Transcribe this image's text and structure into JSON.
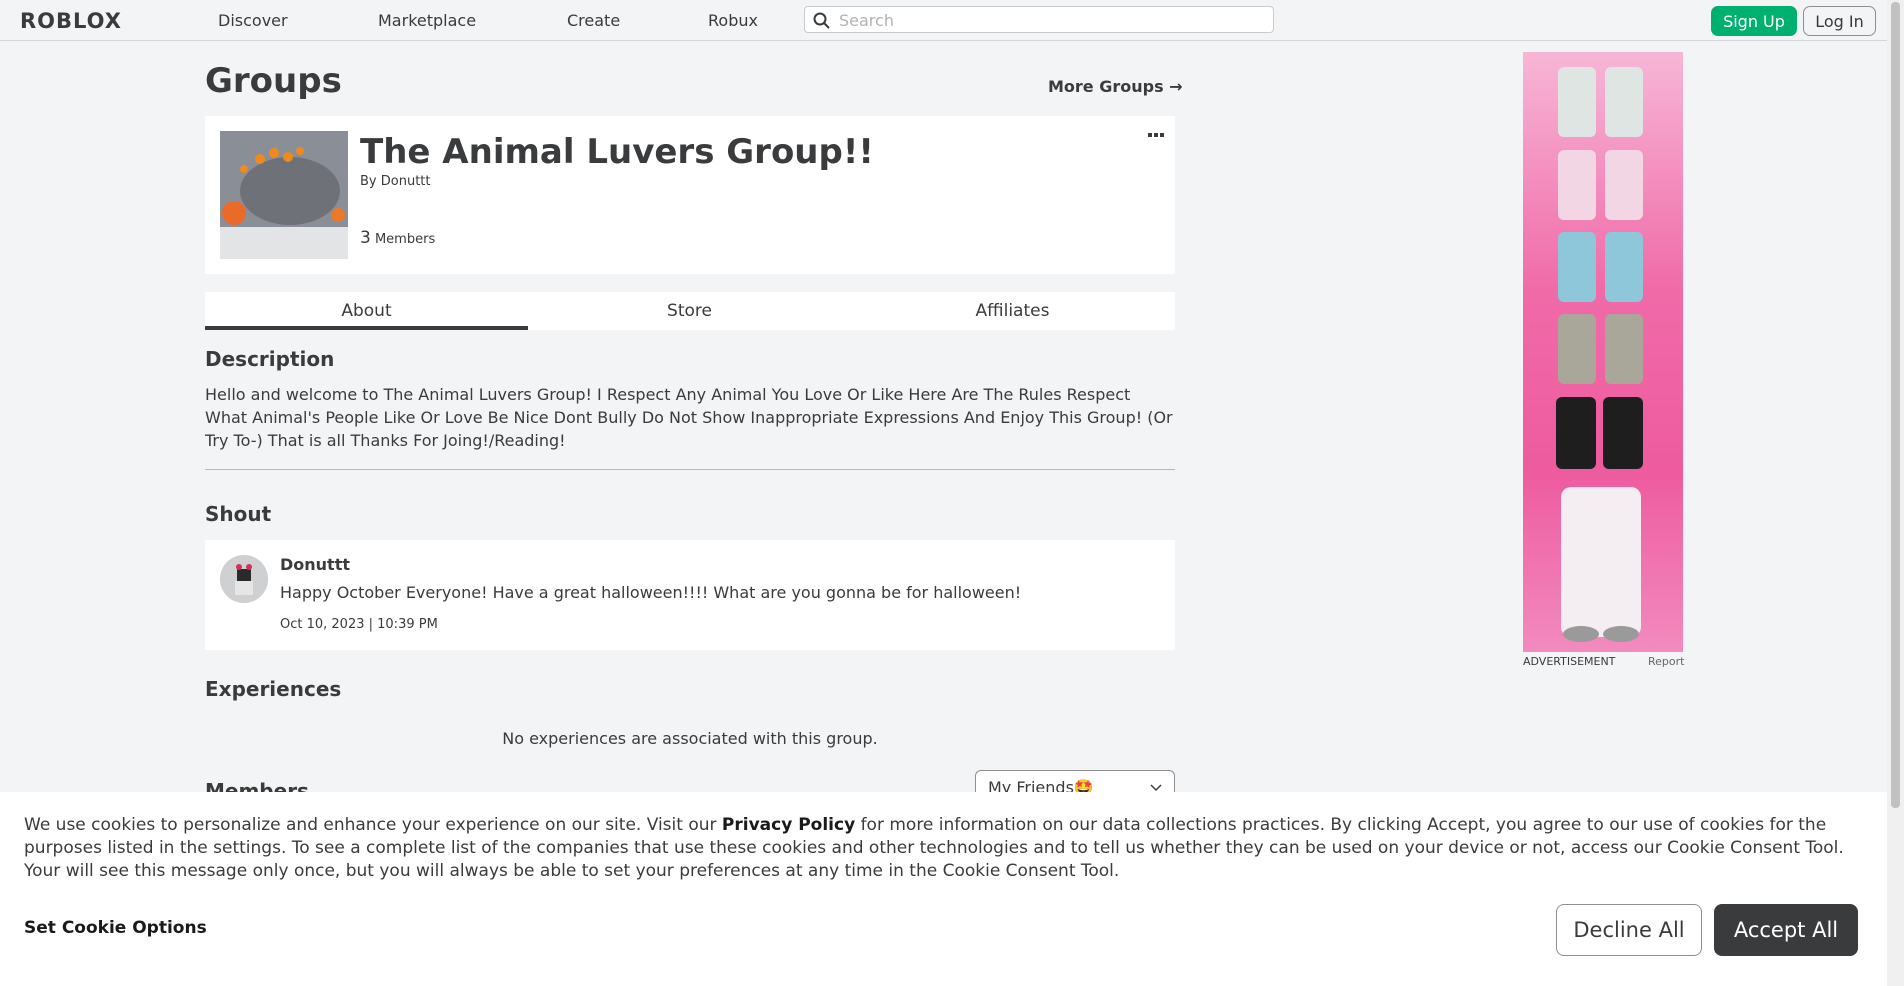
{
  "nav": {
    "logo": "ROBLOX",
    "links": [
      "Discover",
      "Marketplace",
      "Create",
      "Robux"
    ],
    "search_placeholder": "Search",
    "sign_up": "Sign Up",
    "log_in": "Log In"
  },
  "page": {
    "title": "Groups",
    "more_groups": "More Groups →"
  },
  "group": {
    "name": "The Animal Luvers Group!!",
    "by_label": "By",
    "owner": "Donuttt",
    "members_count": "3",
    "members_label": "Members"
  },
  "tabs": [
    "About",
    "Store",
    "Affiliates"
  ],
  "about": {
    "description_heading": "Description",
    "description": "Hello and welcome to The Animal Luvers Group! I Respect Any Animal You Love Or Like Here Are The Rules Respect What Animal's People Like Or Love Be Nice Dont Bully Do Not Show Inappropriate Expressions And Enjoy This Group! (Or Try To-) That is all Thanks For Joing!/Reading!",
    "shout_heading": "Shout",
    "shout": {
      "user": "Donuttt",
      "text": "Happy October Everyone! Have a great halloween!!!! What are you gonna be for halloween!",
      "date": "Oct 10, 2023 | 10:39 PM"
    },
    "experiences_heading": "Experiences",
    "no_experiences": "No experiences are associated with this group.",
    "members_heading": "Members",
    "friends_select": "My Friends🤩"
  },
  "ad": {
    "label": "ADVERTISEMENT",
    "report": "Report"
  },
  "cookie": {
    "text_before": "We use cookies to personalize and enhance your experience on our site. Visit our ",
    "privacy_link": "Privacy Policy",
    "text_after": " for more information on our data collections practices. By clicking Accept, you agree to our use of cookies for the purposes listed in the settings. To see a complete list of the companies that use these cookies and other technologies and to tell us whether they can be used on your device or not, access our Cookie Consent Tool. Your will see this message only once, but you will always be able to set your preferences at any time in the Cookie Consent Tool.",
    "set_options": "Set Cookie Options",
    "decline": "Decline All",
    "accept": "Accept All"
  },
  "colors": {
    "accent_green": "#00b06f",
    "text": "#393b3d",
    "background": "#f2f4f5"
  }
}
